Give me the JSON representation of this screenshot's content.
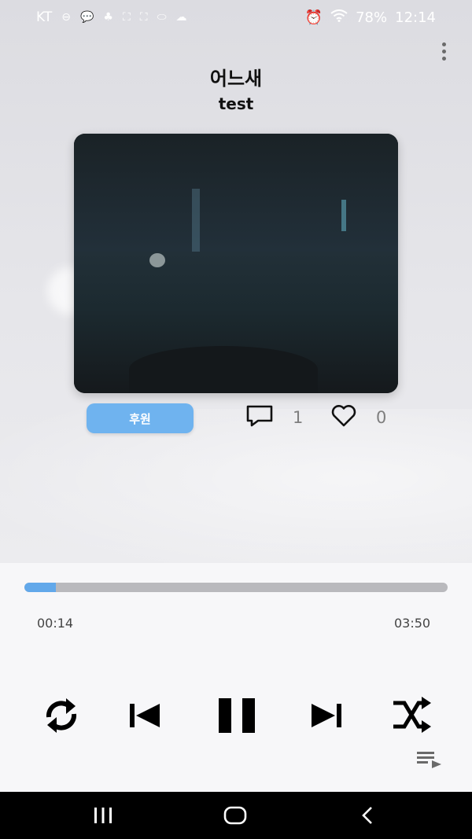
{
  "status_bar": {
    "carrier": "KT",
    "battery": "78%",
    "time": "12:14",
    "left_icons": [
      "minus-circle-icon",
      "kakaotalk-icon",
      "app-icon",
      "screenshot-icon",
      "screenshot-icon",
      "pill-icon",
      "cloud-icon"
    ],
    "right_icons": [
      "alarm-icon",
      "wifi-icon"
    ]
  },
  "track": {
    "title": "어느새",
    "artist": "test"
  },
  "actions": {
    "support_label": "후원",
    "comment_count": "1",
    "like_count": "0"
  },
  "progress": {
    "current_time": "00:14",
    "total_time": "03:50",
    "fraction": 0.075
  },
  "controls": [
    "repeat-icon",
    "skip-previous-icon",
    "pause-icon",
    "skip-next-icon",
    "shuffle-icon",
    "queue-icon"
  ],
  "colors": {
    "accent": "#62a8ea",
    "button": "#6fb3ef",
    "track_bg": "#b9b9bd"
  }
}
